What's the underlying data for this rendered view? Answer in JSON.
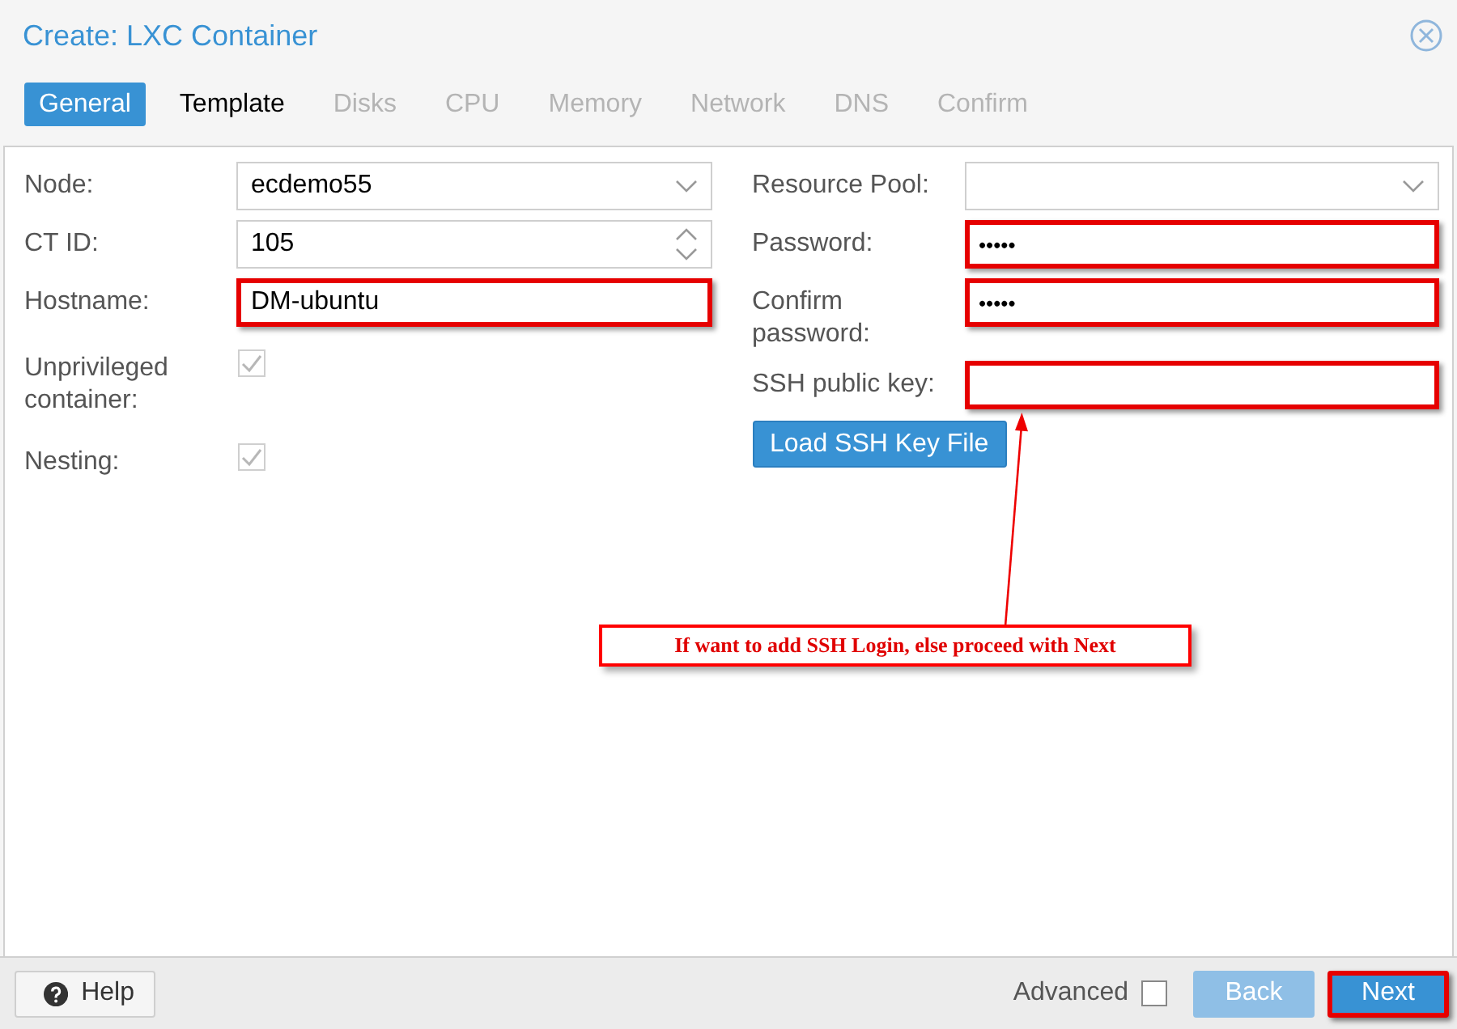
{
  "window": {
    "title": "Create: LXC Container"
  },
  "tabs": [
    {
      "label": "General",
      "selected": true,
      "disabled": false
    },
    {
      "label": "Template",
      "selected": false,
      "disabled": false
    },
    {
      "label": "Disks",
      "selected": false,
      "disabled": true
    },
    {
      "label": "CPU",
      "selected": false,
      "disabled": true
    },
    {
      "label": "Memory",
      "selected": false,
      "disabled": true
    },
    {
      "label": "Network",
      "selected": false,
      "disabled": true
    },
    {
      "label": "DNS",
      "selected": false,
      "disabled": true
    },
    {
      "label": "Confirm",
      "selected": false,
      "disabled": true
    }
  ],
  "left_fields": [
    {
      "kind": "combo",
      "label": "Node:",
      "value": "ecdemo55",
      "highlighted": false
    },
    {
      "kind": "spinner",
      "label": "CT ID:",
      "value": "105",
      "highlighted": false
    },
    {
      "kind": "text",
      "label": "Hostname:",
      "value": "DM-ubuntu",
      "highlighted": true
    },
    {
      "kind": "checkbox",
      "label": "Unprivileged container:",
      "checked": true,
      "disabled": true
    },
    {
      "kind": "checkbox",
      "label": "Nesting:",
      "checked": true,
      "disabled": true
    }
  ],
  "right_fields": [
    {
      "kind": "combo",
      "label": "Resource Pool:",
      "highlighted": false
    },
    {
      "kind": "password",
      "label": "Password:",
      "value": "•••••",
      "highlighted": true
    },
    {
      "kind": "password",
      "label": "Confirm password:",
      "value": "•••••",
      "highlighted": true
    },
    {
      "kind": "text",
      "label": "SSH public key:",
      "highlighted": true
    },
    {
      "kind": "button",
      "label": "Load SSH Key File"
    }
  ],
  "annotation": {
    "text": "If want to add SSH Login, else proceed with Next"
  },
  "footer": {
    "help": "Help",
    "advanced": {
      "label": "Advanced",
      "checked": false
    },
    "buttons": [
      {
        "label": "Back",
        "disabled": true,
        "highlighted": false
      },
      {
        "label": "Next",
        "disabled": false,
        "highlighted": true
      }
    ]
  }
}
